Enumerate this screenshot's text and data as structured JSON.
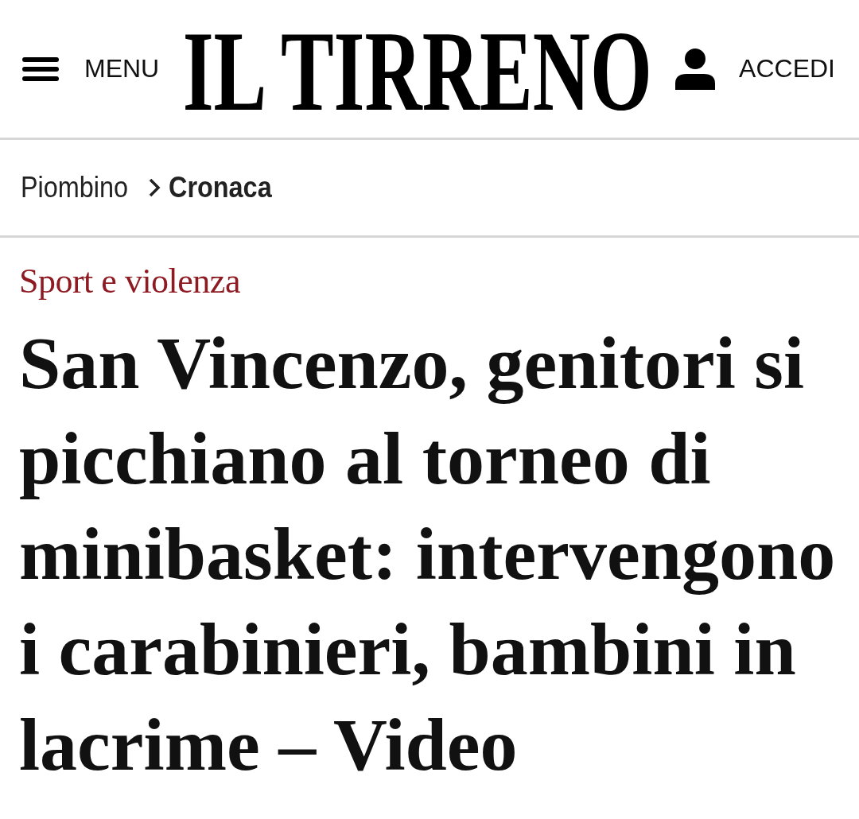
{
  "header": {
    "menu_label": "MENU",
    "logo": "IL TIRRENO",
    "login_label": "ACCEDI"
  },
  "breadcrumb": [
    {
      "label": "Piombino",
      "current": false
    },
    {
      "label": "Cronaca",
      "current": true
    }
  ],
  "article": {
    "kicker": "Sport e violenza",
    "headline": "San Vincenzo, genitori si picchiano al torneo di minibasket: intervengono i carabinieri, bambini in lacrime – Video"
  }
}
